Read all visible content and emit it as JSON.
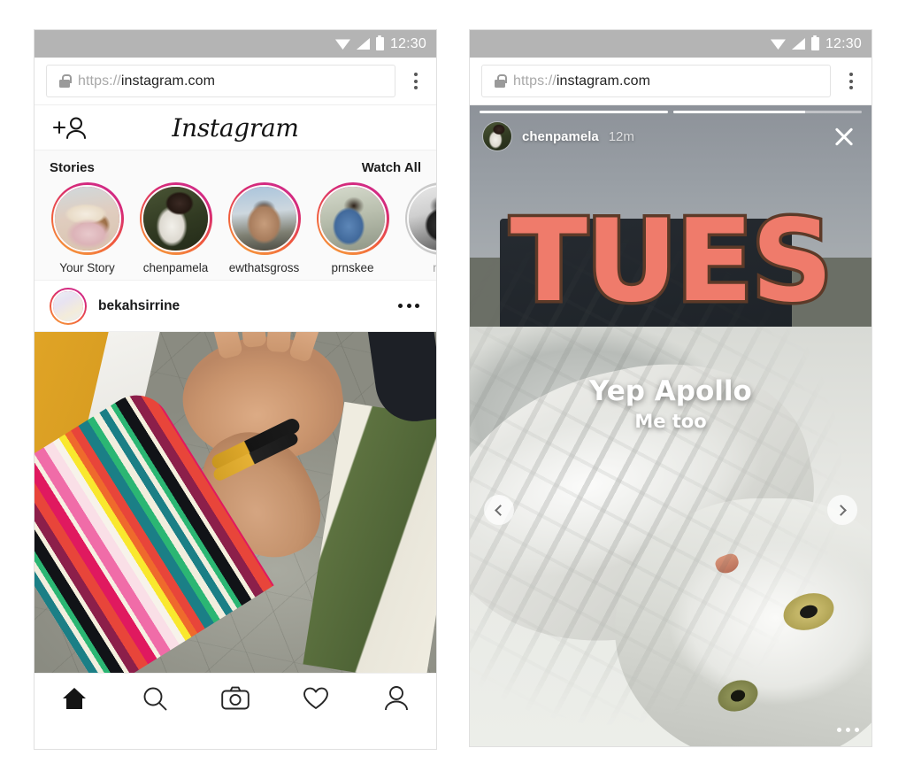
{
  "statusbar": {
    "time": "12:30",
    "icons": [
      "wifi-icon",
      "signal-icon",
      "battery-icon"
    ]
  },
  "browser": {
    "lock_icon": "lock-icon",
    "url_scheme": "https://",
    "url_host": "instagram.com",
    "menu_icon": "kebab-menu-icon"
  },
  "feed": {
    "header": {
      "add_person_icon": "add-person-icon",
      "logo": "Instagram"
    },
    "stories": {
      "title": "Stories",
      "watch_all": "Watch All",
      "items": [
        {
          "name": "Your Story",
          "seen": false,
          "art": "av-yourstory"
        },
        {
          "name": "chenpamela",
          "seen": false,
          "art": "av-chenpamela"
        },
        {
          "name": "ewthatsgross",
          "seen": false,
          "art": "av-ewthatsgross"
        },
        {
          "name": "prnskee",
          "seen": false,
          "art": "av-prnskee"
        },
        {
          "name": "mo",
          "seen": true,
          "art": "av-mo"
        }
      ]
    },
    "post": {
      "username": "bekahsirrine",
      "more_icon": "post-more-icon",
      "photo_alt": "outstretched-hand-with-striped-blanket"
    },
    "bottom_nav": [
      {
        "icon": "home-icon",
        "active": true
      },
      {
        "icon": "search-icon",
        "active": false
      },
      {
        "icon": "camera-icon",
        "active": false
      },
      {
        "icon": "heart-icon",
        "active": false
      },
      {
        "icon": "profile-icon",
        "active": false
      }
    ]
  },
  "story_viewer": {
    "progress": [
      100,
      70
    ],
    "username": "chenpamela",
    "timestamp": "12m",
    "close_icon": "close-icon",
    "prev_icon": "chevron-left-icon",
    "next_icon": "chevron-right-icon",
    "more_icon": "story-more-icon",
    "overlay_big": "TUES",
    "overlay_line1": "Yep Apollo",
    "overlay_line2": "Me too",
    "photo_alt": "grey-tabby-cat-lying-on-bed",
    "colors": {
      "big_text_fill": "#ef7b6b",
      "big_text_stroke": "#5c3a28",
      "overlay_text": "#ffffff"
    }
  },
  "colors": {
    "status_bar": "#b4b4b4",
    "ring_gradient_start": "#cf2e92",
    "ring_gradient_end": "#f7a83b",
    "ring_seen": "#c9c9c9",
    "page_bg": "#ffffff"
  }
}
